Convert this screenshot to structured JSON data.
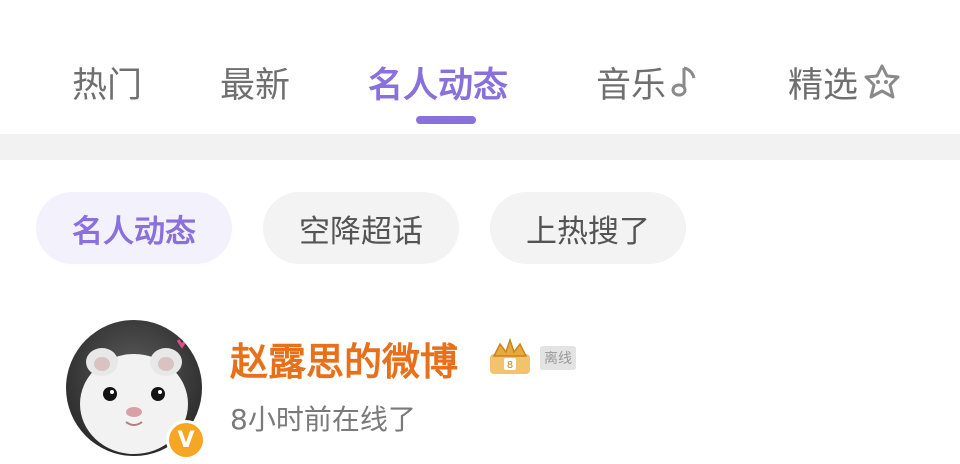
{
  "tabs": {
    "items": [
      {
        "label": "热门",
        "active": false
      },
      {
        "label": "最新",
        "active": false
      },
      {
        "label": "名人动态",
        "active": true
      },
      {
        "label": "音乐",
        "active": false,
        "icon": "music-note-icon"
      },
      {
        "label": "精选",
        "active": false,
        "icon": "star-face-icon"
      }
    ]
  },
  "chips": [
    {
      "label": "名人动态",
      "active": true
    },
    {
      "label": "空降超话",
      "active": false
    },
    {
      "label": "上热搜了",
      "active": false
    }
  ],
  "user": {
    "name": "赵露思的微博",
    "status_badge": "离线",
    "last_online": "8小时前在线了",
    "verified_badge": "V",
    "badge_icon": "crown-badge-icon",
    "avatar": "hamster-avatar"
  },
  "colors": {
    "accent": "#8a70dc",
    "username": "#e8701a",
    "verified": "#f5a623"
  }
}
